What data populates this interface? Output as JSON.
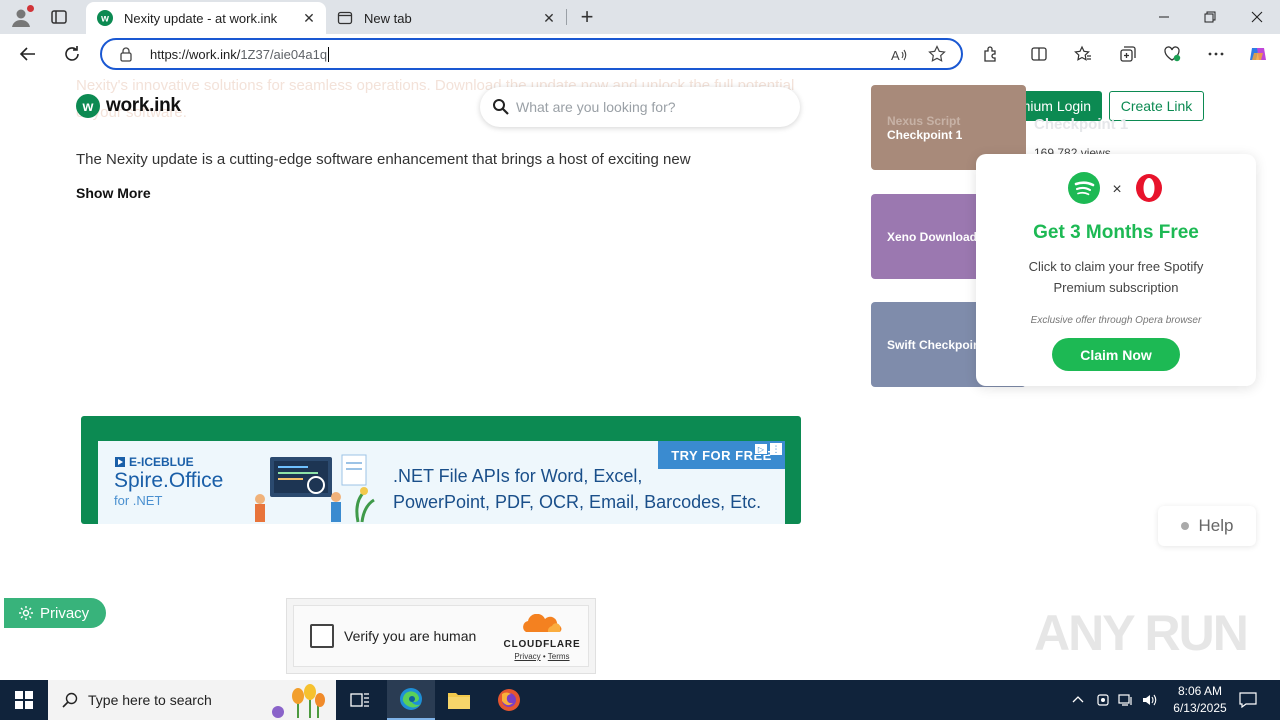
{
  "browser": {
    "tabs": [
      {
        "title": "Nexity update - at work.ink",
        "active": true
      },
      {
        "title": "New tab",
        "active": false
      }
    ],
    "url_host": "https://work.ink/",
    "url_path": "1Z37/aie04a1q"
  },
  "site": {
    "faded_text": "Nexity's innovative solutions for seamless operations. Download the update now and unlock the full potential of your software.",
    "logo_text": "work.ink",
    "search_placeholder": "What are you looking for?",
    "premium_login": "Premium Login",
    "create_link": "Create Link",
    "description": "The Nexity update is a cutting-edge software enhancement that brings a host of exciting new",
    "show_more": "Show More"
  },
  "cards": [
    {
      "line1": "Nexus Script",
      "line2": "Checkpoint 1"
    },
    {
      "label": "Xeno Download"
    },
    {
      "label": "Swift Checkpoint"
    }
  ],
  "card_meta": {
    "title": "Checkpoint 1",
    "views": "169,782 views"
  },
  "promo": {
    "heading": "Get 3 Months Free",
    "subtitle": "Click to claim your free Spotify Premium subscription",
    "exclusive": "Exclusive offer through Opera browser",
    "claim": "Claim Now",
    "times": "×",
    "accent": "#1db954"
  },
  "ad": {
    "brand": "E-ICEBLUE",
    "product": "Spire.Office",
    "product_sub": "for .NET",
    "line1": ".NET File APIs for Word, Excel,",
    "line2": "PowerPoint, PDF, OCR, Email, Barcodes, Etc.",
    "try": "TRY FOR FREE"
  },
  "help": "Help",
  "privacy": "Privacy",
  "captcha": {
    "label": "Verify you are human",
    "brand": "CLOUDFLARE",
    "privacy": "Privacy",
    "sep": "•",
    "terms": "Terms"
  },
  "watermark": "ANY RUN",
  "taskbar": {
    "search_placeholder": "Type here to search",
    "time": "8:06 AM",
    "date": "6/13/2025"
  },
  "colors": {
    "brand_green": "#0c8a52",
    "omnibox_border": "#1a58d2",
    "taskbar": "#10233b"
  }
}
